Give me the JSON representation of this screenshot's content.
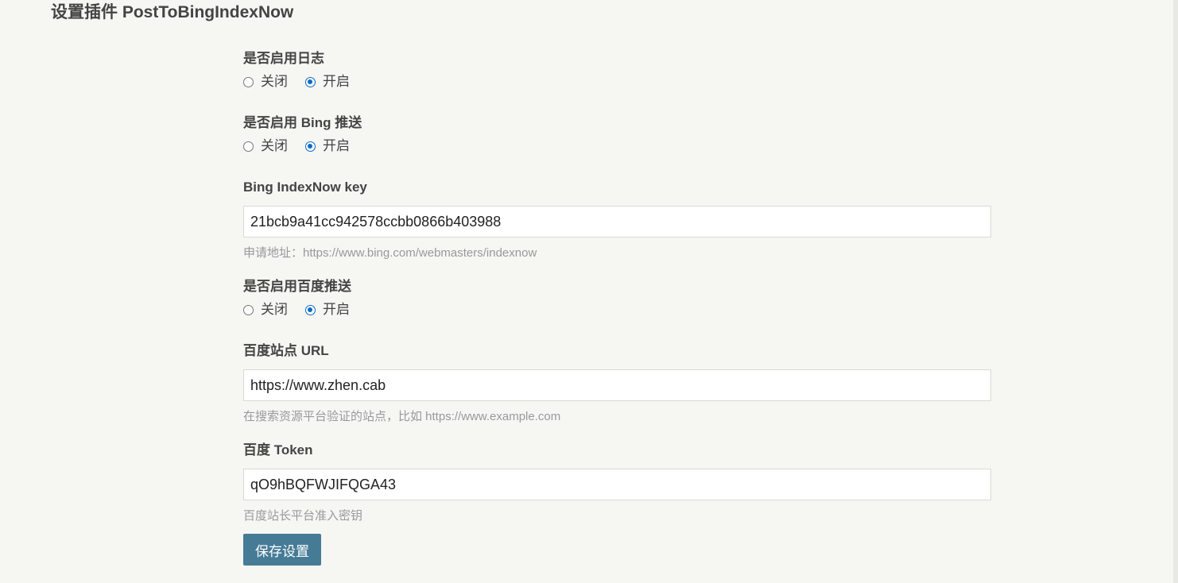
{
  "page": {
    "title": "设置插件 PostToBingIndexNow"
  },
  "form": {
    "enable_log": {
      "label": "是否启用日志",
      "options": [
        "关闭",
        "开启"
      ],
      "selected": "开启"
    },
    "enable_bing": {
      "label": "是否启用 Bing 推送",
      "options": [
        "关闭",
        "开启"
      ],
      "selected": "开启"
    },
    "bing_key": {
      "label": "Bing IndexNow key",
      "value": "21bcb9a41cc942578ccbb0866b403988",
      "hint": "申请地址：https://www.bing.com/webmasters/indexnow"
    },
    "enable_baidu": {
      "label": "是否启用百度推送",
      "options": [
        "关闭",
        "开启"
      ],
      "selected": "开启"
    },
    "baidu_url": {
      "label": "百度站点 URL",
      "value": "https://www.zhen.cab",
      "hint": "在搜索资源平台验证的站点，比如 https://www.example.com"
    },
    "baidu_token": {
      "label": "百度 Token",
      "value": "qO9hBQFWJIFQGA43",
      "hint": "百度站长平台准入密钥"
    },
    "save_label": "保存设置"
  },
  "colors": {
    "background": "#f6f6f3",
    "accent_radio": "#0a6bc7",
    "button": "#467b96"
  }
}
